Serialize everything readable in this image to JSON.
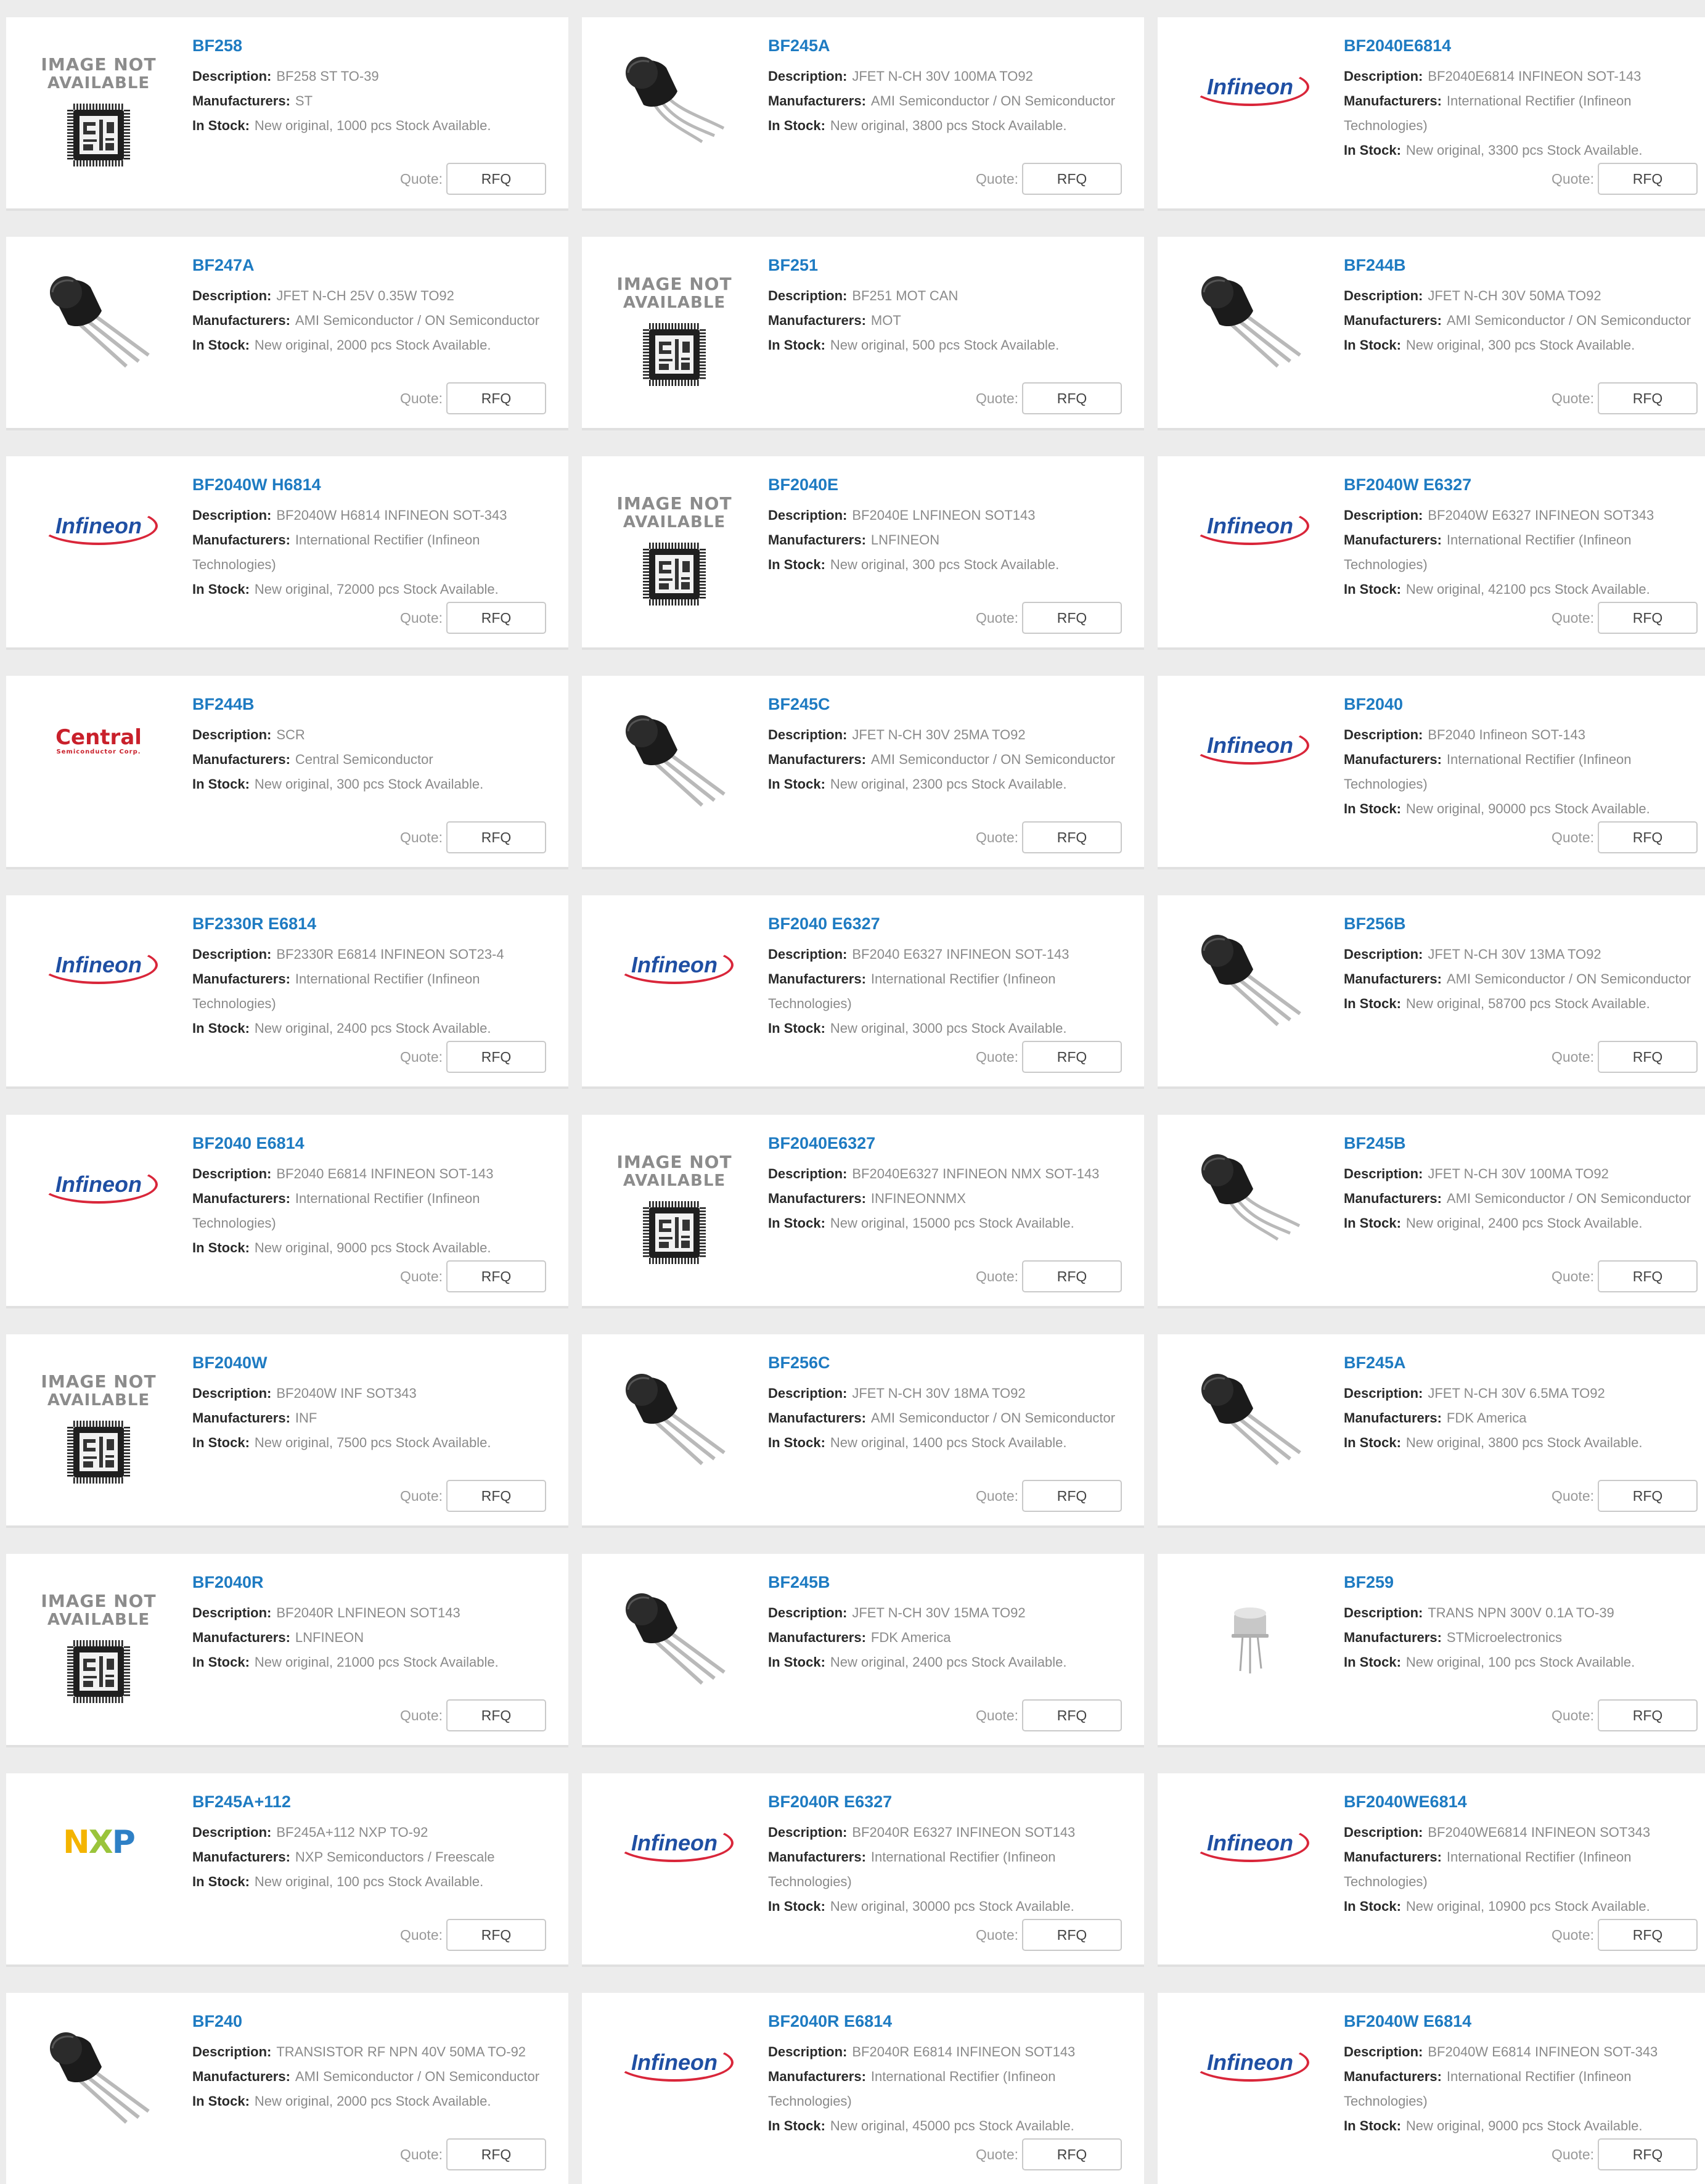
{
  "labels": {
    "description": "Description:",
    "manufacturers": "Manufacturers:",
    "in_stock": "In Stock:",
    "quote": "Quote:",
    "rfq": "RFQ"
  },
  "placeholder_image": {
    "line1": "IMAGE NOT",
    "line2": "AVAILABLE"
  },
  "logo_text": {
    "infineon": "Infineon",
    "central_main": "Central",
    "central_sub": "Semiconductor Corp.",
    "nxp": "NXP"
  },
  "colors": {
    "link": "#1e7bc2",
    "infineon_blue": "#1f4fa3",
    "infineon_red": "#d9263a",
    "central_red": "#c9202b",
    "nxp_yellow": "#f4b400",
    "nxp_green": "#9ac43b",
    "nxp_blue": "#2e80c6"
  },
  "products": [
    {
      "title": "BF258",
      "image": "not-available",
      "description": "BF258 ST TO-39",
      "manufacturer": "ST",
      "stock": "New original, 1000 pcs Stock Available."
    },
    {
      "title": "BF245A",
      "image": "to92-bent",
      "description": "JFET N-CH 30V 100MA TO92",
      "manufacturer": "AMI Semiconductor / ON Semiconductor",
      "stock": "New original, 3800 pcs Stock Available."
    },
    {
      "title": "BF2040E6814",
      "image": "infineon",
      "description": "BF2040E6814 INFINEON SOT-143",
      "manufacturer": "International Rectifier (Infineon Technologies)",
      "stock": "New original, 3300 pcs Stock Available."
    },
    {
      "title": "BF247A",
      "image": "to92",
      "description": "JFET N-CH 25V 0.35W TO92",
      "manufacturer": "AMI Semiconductor / ON Semiconductor",
      "stock": "New original, 2000 pcs Stock Available."
    },
    {
      "title": "BF251",
      "image": "not-available",
      "description": "BF251 MOT CAN",
      "manufacturer": "MOT",
      "stock": "New original, 500 pcs Stock Available."
    },
    {
      "title": "BF244B",
      "image": "to92",
      "description": "JFET N-CH 30V 50MA TO92",
      "manufacturer": "AMI Semiconductor / ON Semiconductor",
      "stock": "New original, 300 pcs Stock Available."
    },
    {
      "title": "BF2040W H6814",
      "image": "infineon",
      "description": "BF2040W H6814 INFINEON SOT-343",
      "manufacturer": "International Rectifier (Infineon Technologies)",
      "stock": "New original, 72000 pcs Stock Available."
    },
    {
      "title": "BF2040E",
      "image": "not-available",
      "description": "BF2040E LNFINEON SOT143",
      "manufacturer": "LNFINEON",
      "stock": "New original, 300 pcs Stock Available."
    },
    {
      "title": "BF2040W E6327",
      "image": "infineon",
      "description": "BF2040W E6327 INFINEON SOT343",
      "manufacturer": "International Rectifier (Infineon Technologies)",
      "stock": "New original, 42100 pcs Stock Available."
    },
    {
      "title": "BF244B",
      "image": "central",
      "description": "SCR",
      "manufacturer": "Central Semiconductor",
      "stock": "New original, 300 pcs Stock Available."
    },
    {
      "title": "BF245C",
      "image": "to92",
      "description": "JFET N-CH 30V 25MA TO92",
      "manufacturer": "AMI Semiconductor / ON Semiconductor",
      "stock": "New original, 2300 pcs Stock Available."
    },
    {
      "title": "BF2040",
      "image": "infineon",
      "description": "BF2040 Infineon SOT-143",
      "manufacturer": "International Rectifier (Infineon Technologies)",
      "stock": "New original, 90000 pcs Stock Available."
    },
    {
      "title": "BF2330R E6814",
      "image": "infineon",
      "description": "BF2330R E6814 INFINEON SOT23-4",
      "manufacturer": "International Rectifier (Infineon Technologies)",
      "stock": "New original, 2400 pcs Stock Available."
    },
    {
      "title": "BF2040 E6327",
      "image": "infineon",
      "description": "BF2040 E6327 INFINEON SOT-143",
      "manufacturer": "International Rectifier (Infineon Technologies)",
      "stock": "New original, 3000 pcs Stock Available."
    },
    {
      "title": "BF256B",
      "image": "to92",
      "description": "JFET N-CH 30V 13MA TO92",
      "manufacturer": "AMI Semiconductor / ON Semiconductor",
      "stock": "New original, 58700 pcs Stock Available."
    },
    {
      "title": "BF2040 E6814",
      "image": "infineon",
      "description": "BF2040 E6814 INFINEON SOT-143",
      "manufacturer": "International Rectifier (Infineon Technologies)",
      "stock": "New original, 9000 pcs Stock Available."
    },
    {
      "title": "BF2040E6327",
      "image": "not-available",
      "description": "BF2040E6327 INFINEON  NMX SOT-143",
      "manufacturer": "INFINEONNMX",
      "stock": "New original, 15000 pcs Stock Available."
    },
    {
      "title": "BF245B",
      "image": "to92-bent",
      "description": "JFET N-CH 30V 100MA TO92",
      "manufacturer": "AMI Semiconductor / ON Semiconductor",
      "stock": "New original, 2400 pcs Stock Available."
    },
    {
      "title": "BF2040W",
      "image": "not-available",
      "description": "BF2040W INF SOT343",
      "manufacturer": "INF",
      "stock": "New original, 7500 pcs Stock Available."
    },
    {
      "title": "BF256C",
      "image": "to92",
      "description": "JFET N-CH 30V 18MA TO92",
      "manufacturer": "AMI Semiconductor / ON Semiconductor",
      "stock": "New original, 1400 pcs Stock Available."
    },
    {
      "title": "BF245A",
      "image": "to92",
      "description": "JFET N-CH 30V 6.5MA TO92",
      "manufacturer": "FDK America",
      "stock": "New original, 3800 pcs Stock Available."
    },
    {
      "title": "BF2040R",
      "image": "not-available",
      "description": "BF2040R LNFINEON SOT143",
      "manufacturer": "LNFINEON",
      "stock": "New original, 21000 pcs Stock Available."
    },
    {
      "title": "BF245B",
      "image": "to92",
      "description": "JFET N-CH 30V 15MA TO92",
      "manufacturer": "FDK America",
      "stock": "New original, 2400 pcs Stock Available."
    },
    {
      "title": "BF259",
      "image": "to39-can",
      "description": "TRANS NPN 300V 0.1A TO-39",
      "manufacturer": "STMicroelectronics",
      "stock": "New original, 100 pcs Stock Available."
    },
    {
      "title": "BF245A+112",
      "image": "nxp",
      "description": "BF245A+112 NXP TO-92",
      "manufacturer": "NXP Semiconductors / Freescale",
      "stock": "New original, 100 pcs Stock Available."
    },
    {
      "title": "BF2040R E6327",
      "image": "infineon",
      "description": "BF2040R E6327 INFINEON SOT143",
      "manufacturer": "International Rectifier (Infineon Technologies)",
      "stock": "New original, 30000 pcs Stock Available."
    },
    {
      "title": "BF2040WE6814",
      "image": "infineon",
      "description": "BF2040WE6814   INFINEON SOT343",
      "manufacturer": "International Rectifier (Infineon Technologies)",
      "stock": "New original, 10900 pcs Stock Available."
    },
    {
      "title": "BF240",
      "image": "to92",
      "description": "TRANSISTOR RF NPN 40V 50MA TO-92",
      "manufacturer": "AMI Semiconductor / ON Semiconductor",
      "stock": "New original, 2000 pcs Stock Available."
    },
    {
      "title": "BF2040R E6814",
      "image": "infineon",
      "description": "BF2040R E6814 INFINEON SOT143",
      "manufacturer": "International Rectifier (Infineon Technologies)",
      "stock": "New original, 45000 pcs Stock Available."
    },
    {
      "title": "BF2040W E6814",
      "image": "infineon",
      "description": "BF2040W E6814 INFINEON SOT-343",
      "manufacturer": "International Rectifier (Infineon Technologies)",
      "stock": "New original, 9000 pcs Stock Available."
    }
  ]
}
